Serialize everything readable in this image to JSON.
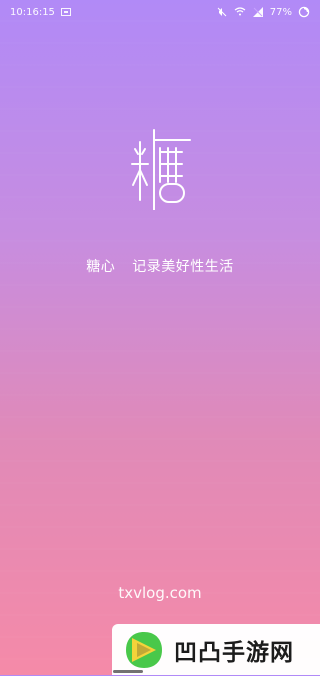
{
  "status_bar": {
    "time": "10:16:15",
    "battery": "77%",
    "icons": [
      "image-icon",
      "mute-icon",
      "wifi-icon",
      "signal-icon",
      "battery-circle-icon"
    ]
  },
  "splash": {
    "logo_icon": "tang-logo-icon",
    "tagline_brand": "糖心",
    "tagline_text": "记录美好性生活",
    "site": "txvlog.com"
  },
  "watermark": {
    "icon": "play-icon",
    "text": "凹凸手游网"
  },
  "colors": {
    "top": "#b18af7",
    "mid": "#c78de0",
    "bottom": "#f58aa8",
    "white": "#ffffff",
    "wm_green": "#49c84a",
    "wm_yellow": "#f5d33a"
  }
}
